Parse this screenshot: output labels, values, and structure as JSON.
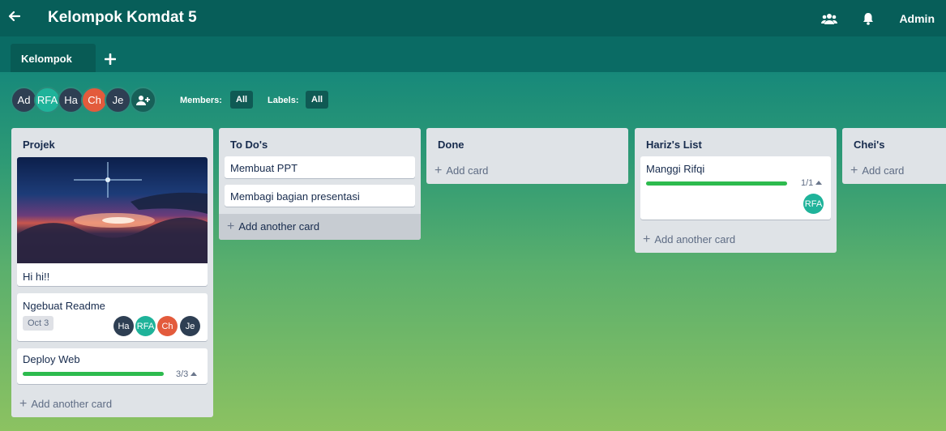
{
  "header": {
    "title": "Kelompok Komdat 5",
    "admin_label": "Admin"
  },
  "tabs": [
    {
      "label": "Kelompok"
    }
  ],
  "members": [
    {
      "initials": "Ad",
      "color": "#2e3f53"
    },
    {
      "initials": "RFA",
      "color": "#1fb39a"
    },
    {
      "initials": "Ha",
      "color": "#2e3f53"
    },
    {
      "initials": "Ch",
      "color": "#e35b3c"
    },
    {
      "initials": "Je",
      "color": "#2e3f53"
    }
  ],
  "filters": {
    "members_label": "Members:",
    "members_value": "All",
    "labels_label": "Labels:",
    "labels_value": "All"
  },
  "lists": [
    {
      "title": "Projek",
      "cards": [
        {
          "title": "Hi hi!!",
          "has_image": true
        },
        {
          "title": "Ngebuat Readme",
          "date": "Oct 3",
          "members": [
            "Ha",
            "RFA",
            "Ch",
            "Je"
          ]
        },
        {
          "title": "Deploy Web",
          "progress_label": "3/3",
          "progress": 1.0
        }
      ],
      "add_label": "Add another card"
    },
    {
      "title": "To Do's",
      "cards": [
        {
          "title": "Membuat PPT"
        },
        {
          "title": "Membagi bagian presentasi"
        }
      ],
      "add_label": "Add another card"
    },
    {
      "title": "Done",
      "cards": [],
      "add_label": "Add card"
    },
    {
      "title": "Hariz's List",
      "cards": [
        {
          "title": "Manggi Rifqi",
          "progress_label": "1/1",
          "progress": 1.0,
          "members": [
            "RFA"
          ]
        }
      ],
      "add_label": "Add another card"
    },
    {
      "title": "Chei's",
      "cards": [],
      "add_label": "Add card"
    }
  ],
  "colors": {
    "topbar": "#075e59",
    "progress": "#2dbb4e",
    "list_bg": "#dfe3e7"
  }
}
